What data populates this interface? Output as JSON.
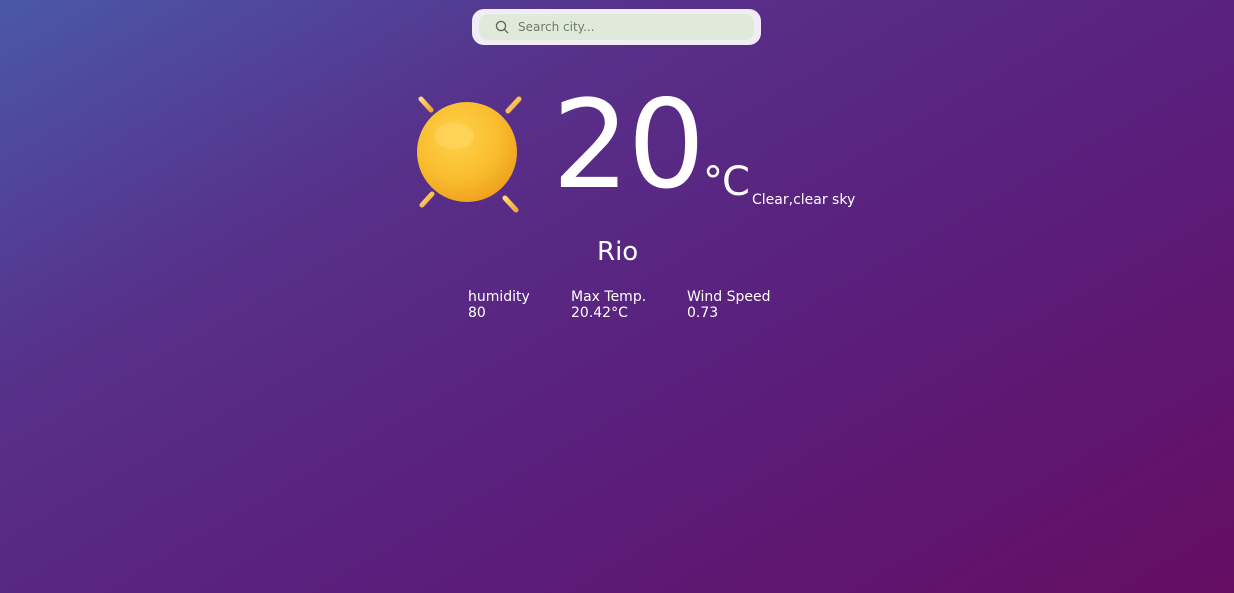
{
  "search": {
    "placeholder": "Search city..."
  },
  "weather": {
    "icon": "sun-icon",
    "temperature": "20",
    "unit": "°C",
    "condition": "Clear,clear sky",
    "city": "Rio"
  },
  "stats": [
    {
      "label": "humidity",
      "value": "80"
    },
    {
      "label": "Max Temp.",
      "value": "20.42°C"
    },
    {
      "label": "Wind Speed",
      "value": "0.73"
    }
  ],
  "colors": {
    "sun": "#f7b92e",
    "ray": "#f2b23e",
    "search_field": "#dfeadb",
    "search_frame": "#f1ecf6"
  }
}
